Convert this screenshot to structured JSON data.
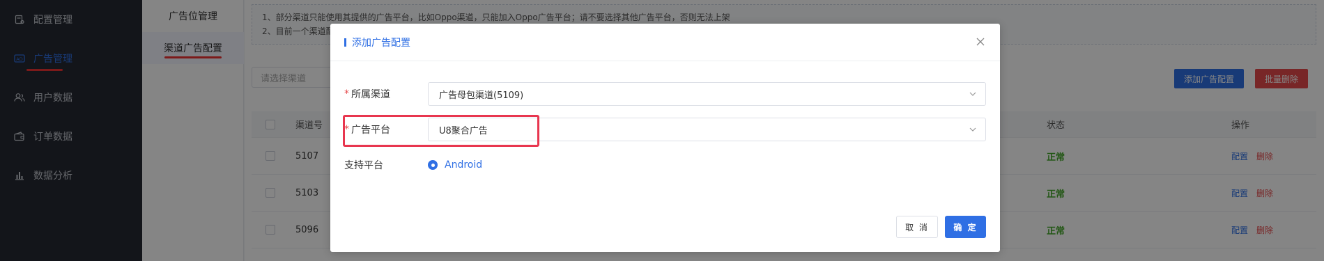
{
  "sidebar": {
    "items": [
      {
        "label": "配置管理",
        "icon": "config-icon"
      },
      {
        "label": "广告管理",
        "icon": "ad-icon",
        "active": true
      },
      {
        "label": "用户数据",
        "icon": "users-icon"
      },
      {
        "label": "订单数据",
        "icon": "wallet-icon"
      },
      {
        "label": "数据分析",
        "icon": "bar-chart-icon"
      }
    ]
  },
  "submenu": {
    "items": [
      {
        "label": "广告位管理"
      },
      {
        "label": "渠道广告配置",
        "active": true
      }
    ]
  },
  "main": {
    "notice": [
      "1、部分渠道只能使用其提供的广告平台，比如Oppo渠道，只能加入Oppo广告平台；请不要选择其他广告平台，否则无法上架",
      "2、目前一个渠道配"
    ],
    "filter_placeholder": "请选择渠道",
    "add_button": "添加广告配置",
    "batch_delete_button": "批量删除",
    "table": {
      "headers": {
        "channel_no": "渠道号",
        "status": "状态",
        "actions": "操作"
      },
      "rows": [
        {
          "channel_no": "5107",
          "status": "正常",
          "config": "配置",
          "delete": "删除"
        },
        {
          "channel_no": "5103",
          "status": "正常",
          "config": "配置",
          "delete": "删除"
        },
        {
          "channel_no": "5096",
          "status": "正常",
          "config": "配置",
          "delete": "删除"
        }
      ]
    }
  },
  "modal": {
    "title": "添加广告配置",
    "fields": {
      "channel": {
        "label": "所属渠道",
        "required": true,
        "value": "广告母包渠道(5109)"
      },
      "platform": {
        "label": "广告平台",
        "required": true,
        "value": "U8聚合广告"
      },
      "support_platform": {
        "label": "支持平台",
        "value": "Android"
      }
    },
    "cancel_label": "取 消",
    "confirm_label": "确 定"
  },
  "colors": {
    "primary": "#2f6fe4",
    "danger": "#e6494b",
    "success": "#44a82a",
    "sidebar_bg": "#262a33",
    "highlight": "#e8364f"
  }
}
